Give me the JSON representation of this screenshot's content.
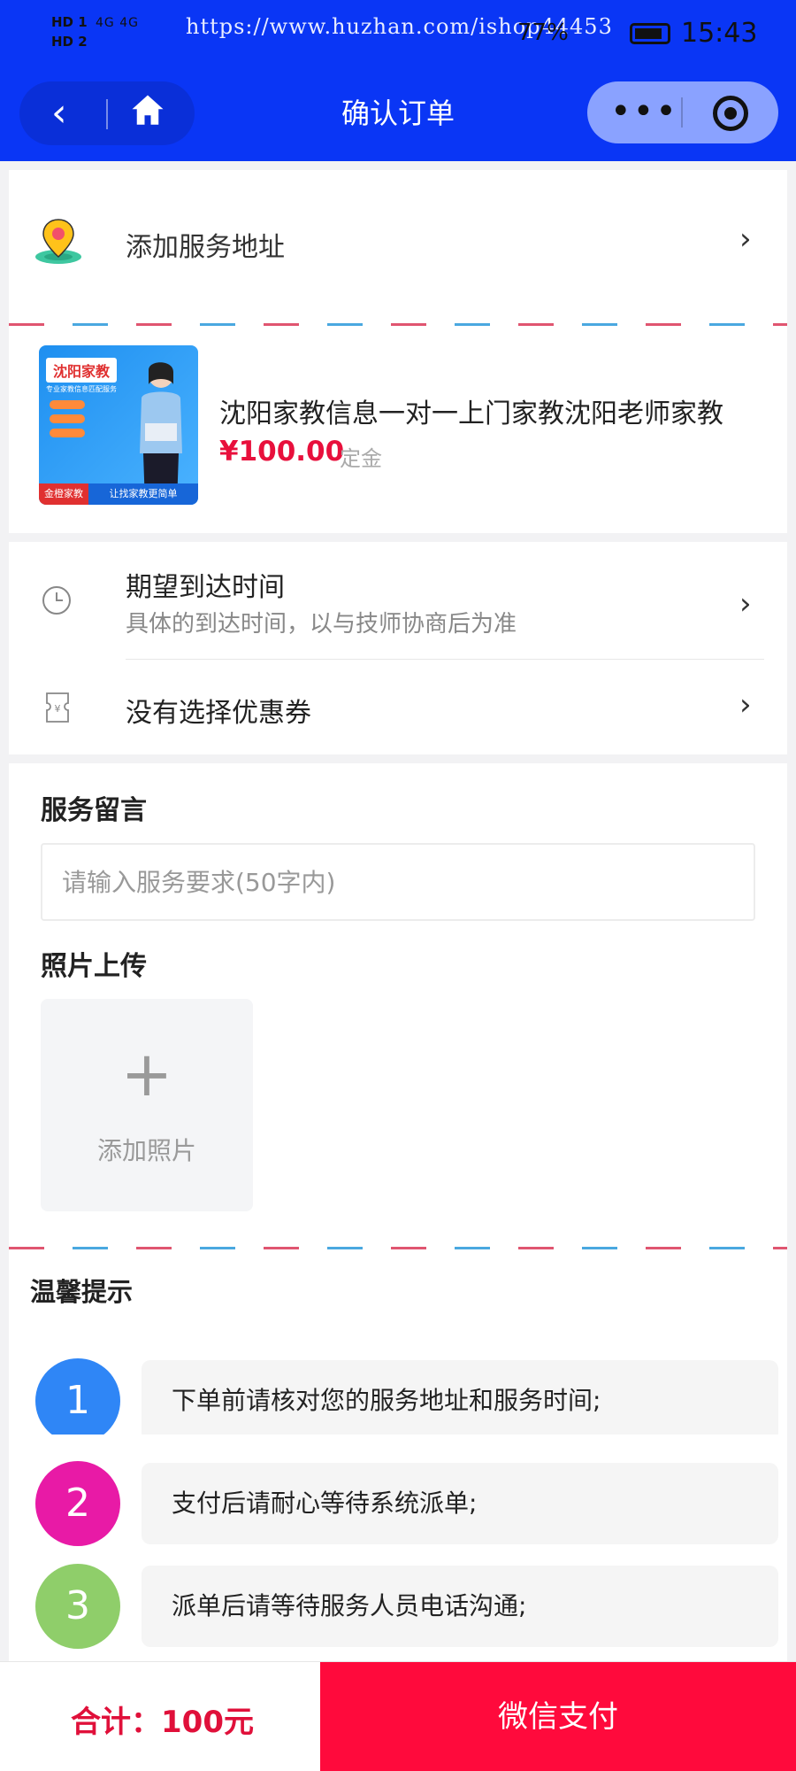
{
  "status_bar": {
    "network_left": "HD 1\nHD 2",
    "signal": "4G 4G",
    "url_watermark": "https://www.huzhan.com/ishop44453",
    "battery": "77%",
    "time": "15:43"
  },
  "nav": {
    "title": "确认订单",
    "back_icon": "chevron-left-icon",
    "home_icon": "home-icon",
    "more_icon": "more-dots-icon",
    "close_icon": "target-icon"
  },
  "address": {
    "label": "添加服务地址"
  },
  "product": {
    "image_tag": "沈阳家教",
    "image_sub": "专业家教信息匹配服务",
    "image_footer_left": "金橙家教",
    "image_footer_right": "让找家教更简单",
    "title": "沈阳家教信息一对一上门家教沈阳老师家教",
    "price": "¥100.00",
    "price_note": "定金"
  },
  "schedule": {
    "title": "期望到达时间",
    "subtitle": "具体的到达时间，以与技师协商后为准",
    "coupon": "没有选择优惠券"
  },
  "message": {
    "label": "服务留言",
    "placeholder": "请输入服务要求(50字内)",
    "value": ""
  },
  "photo": {
    "label": "照片上传",
    "add_symbol": "+",
    "add_label": "添加照片"
  },
  "tips": {
    "title": "温馨提示",
    "items": [
      {
        "num": "1",
        "text": "下单前请核对您的服务地址和服务时间;",
        "color": "#2f86f6"
      },
      {
        "num": "2",
        "text": "支付后请耐心等待系统派单;",
        "color": "#e81aa6"
      },
      {
        "num": "3",
        "text": "派单后请等待服务人员电话沟通;",
        "color": "#8fce6a"
      }
    ]
  },
  "footer": {
    "total": "合计：100元",
    "pay_button": "微信支付"
  },
  "colors": {
    "header_bg": "#0a36f5",
    "price": "#e8103c",
    "pay_button": "#ff0a3c"
  }
}
